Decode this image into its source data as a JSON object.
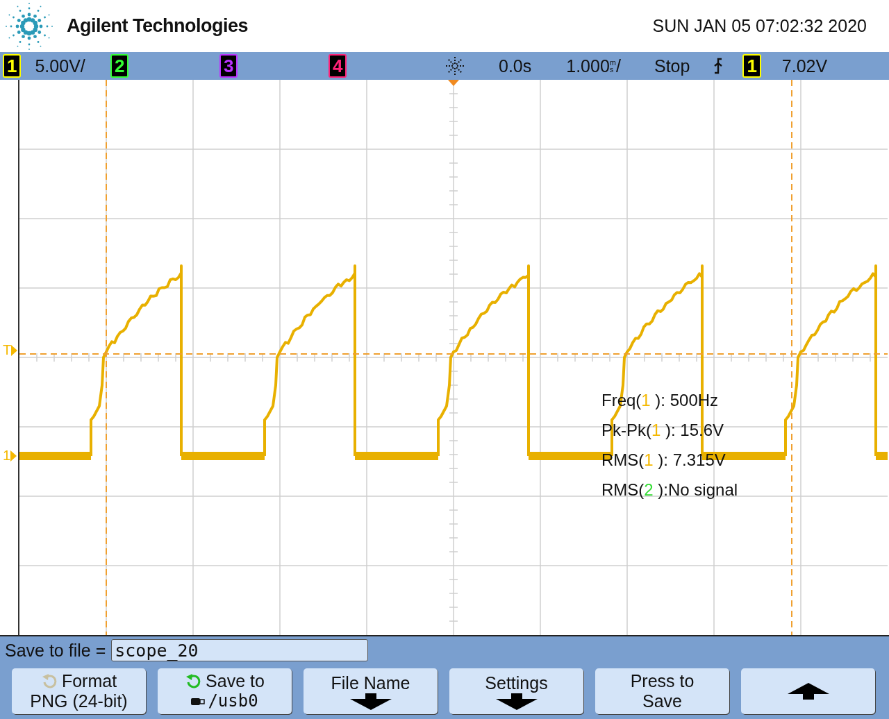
{
  "header": {
    "brand": "Agilent Technologies",
    "datetime": "SUN JAN 05 07:02:32 2020"
  },
  "status_bar": {
    "channels": [
      {
        "label": "1",
        "color": "#ffff00",
        "scale": "5.00V/"
      },
      {
        "label": "2",
        "color": "#33ff33"
      },
      {
        "label": "3",
        "color": "#bb33ff"
      },
      {
        "label": "4",
        "color": "#ff2277"
      }
    ],
    "delay": "0.0s",
    "time_scale": {
      "value": "1.000",
      "unit_top": "m",
      "unit_bottom": "s",
      "suffix": "/"
    },
    "run_state": "Stop",
    "trigger": {
      "source": "1",
      "color": "#ffff00",
      "level": "7.02V"
    }
  },
  "display": {
    "trigger_level_marker": "T",
    "channel_marker": "1",
    "measurements": [
      {
        "prefix": "Freq(",
        "channel": "1",
        "color": "#f5b800",
        "suffix": " ): 500Hz"
      },
      {
        "prefix": "Pk-Pk(",
        "channel": "1",
        "color": "#f5b800",
        "suffix": " ): 15.6V"
      },
      {
        "prefix": "RMS(",
        "channel": "1",
        "color": "#f5b800",
        "suffix": " ): 7.315V"
      },
      {
        "prefix": "RMS(",
        "channel": "2",
        "color": "#33dd33",
        "suffix": " ):No signal"
      }
    ]
  },
  "save_panel": {
    "label": "Save to file =",
    "file_name": "scope_20",
    "softkeys": [
      {
        "kind": "cycle",
        "active": false,
        "title": "Format",
        "value": "PNG (24-bit)",
        "usb": false
      },
      {
        "kind": "cycle",
        "active": true,
        "title": "Save to",
        "value": "/usb0",
        "usb": true
      },
      {
        "kind": "submenu",
        "title": "File Name"
      },
      {
        "kind": "submenu",
        "title": "Settings"
      },
      {
        "kind": "text",
        "lines": [
          "Press to",
          "Save"
        ]
      },
      {
        "kind": "back"
      }
    ]
  }
}
